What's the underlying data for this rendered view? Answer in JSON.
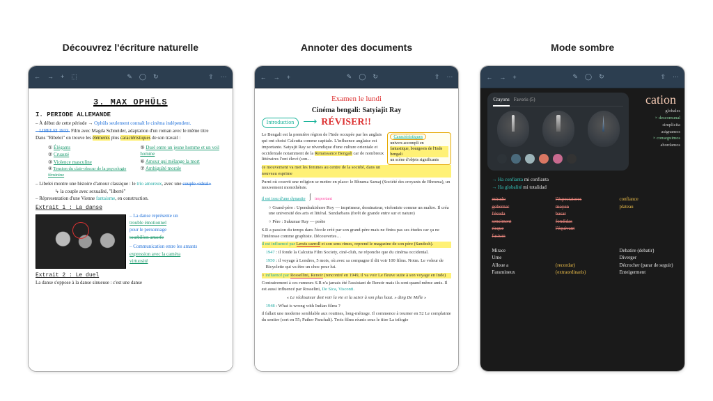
{
  "panels": [
    {
      "title": "Découvrez l'écriture naturelle"
    },
    {
      "title": "Annoter des documents"
    },
    {
      "title": "Mode sombre"
    }
  ],
  "toolbar_icons": [
    "←",
    "→",
    "+",
    "⊕",
    "✎",
    "⬚",
    "◯",
    "↻",
    "<",
    "—",
    "⋯"
  ],
  "panel1": {
    "heading": "3. MAX OPHÜLS",
    "section1": "I. PERIODE ALLEMANDE",
    "l1a": "– À début de cette période →",
    "l1b": "Ophüls seulement connaît le cinéma indépendent.",
    "l2a": "– LIBELEI 1933.",
    "l2b": "Film avec Magda Schneider, adaptation d'un roman avec le même titre",
    "l3a": "Dans \"Ribelei\" on trouve les",
    "l3b": "éléments",
    "l3c": "plus",
    "l3d": "caractéristiques",
    "l3e": "de son travail :",
    "col1": [
      "Élégants",
      "Cruauté",
      "Violence masculine",
      "Tension du clair-obscur de la psycologie féminine"
    ],
    "col2": [
      "Duel entre un jeune homme et un veil homme",
      "Amour qui mélange la mort",
      "Ambiguïté morale"
    ],
    "l4a": "– Libelei montre une histoire d'amour classique : le",
    "l4b": "trio amoreux",
    "l4c": ", avec une",
    "l4d": "couple «ideal»",
    "l4e": "↳ la couple avec sexualité, \"liberté\"",
    "l5a": "– Répresentation d'une Vienne",
    "l5b": "fantaisme",
    "l5c": ", en construction.",
    "extrait1": "Extrait 1 : La danse",
    "p1": [
      "– La danse représente un",
      "trouble émotionnel",
      "pour le personnage",
      "tourbillon amorfe"
    ],
    "p2": [
      "– Communication entre les amants",
      "expression avec la caméra",
      "virtuosité"
    ],
    "extrait2": "Extrait 2 : Le duel",
    "last": "La danse s'oppose à la danse sinueuse : c'est une danse"
  },
  "panel2": {
    "exam": "Examen le lundi",
    "title": "Cinéma bengali: Satyiajit Ray",
    "intro": "Introduction",
    "reviser": "RÉVISER!!",
    "carac_label": "Caractéristiques",
    "carac_lines": [
      "univers accompli en",
      "fantastique, bourgeois de l'Inde bengali",
      "un scène d'objets significants"
    ],
    "body1": "Le Bengali est la première région de l'Inde occupée par les anglais qui ont choisi Calcutta comme capitale. L'influence anglaise est importante. Satyajit Ray se révendique d'une culture orientale et",
    "body1b": "occidentale notamment de la",
    "body1c": "Renaissance Bengali",
    "body1d": "car de nombreux littéraires l'ont élevé (son...",
    "hl1": "ce mouvement va met les femmes au centre de la société, dans un nouveau esprime",
    "body2": "Purni où couvrit une religion se mettre en place: le Bhrama Samaj (Société des croyants de Bhruma), un mouvement monothéiste.",
    "important": "important",
    "under": "il est issu d'une dynastie",
    "dyn": [
      "Grand-père : Upendrakishore Roy — imprimeur, dessinateur, violoniste comme un maître. Il créa une université des arts et littéral. Sundarbans (forêt de grande entre sur et nature)",
      "Père : Sukumar Ray — poète"
    ],
    "sr": "S.R a passion du temps dans l'école créé par son grand-père mais ne finira pas ses études car ça ne l'intéresse comme graphiste. Découvertes…",
    "infl_label": "il est influencé par",
    "lewis": "Lewis carroll",
    "infl_rest": "et son sens rimes, reprend le magazine de son père (Sandesh).",
    "y1947": "1947",
    "y1947t": "il fonde la Calcutta Film Society, ciné-club, ne réponche que du cinéma occidental.",
    "y1950": "1950",
    "y1950t": "il voyage à Londres, 5 mois, où avec sa compagne il dit voir 100 films. Notm. Le voleur de Bicyclette qui va être un choc pour lui.",
    "rosse_label": "influencé par",
    "rosse": "Rossellini, Renoir",
    "rosse_rest": "(rencontré en 1949, il va voir Le fleuve suite à son voyage en Inde)",
    "rosse2": "Contrairement à ces rumeurs S.R n'a jamais été l'assistant de Renoir mais ils sont quand même amis. Il est aussi influencé par Rosselini,",
    "names": "De Sica, Visconti.",
    "quote": "« Le réalisateur doit voir la vie et la saisir à son plus haut. » dtng De Mille »",
    "y1948": "1948",
    "y1948t": "What is wrong with Indian films ?",
    "tail": "il fallait une moderne semblable aux routines, long-métrage. Il commence à tourner en 52 Le complainte du sentier (sort en 55; Pather Panchali). Trois films réunis sous le titre La trilogie"
  },
  "panel3": {
    "script": "cation",
    "tab1": "Crayons",
    "tab2": "Favoris (5)",
    "sidewords": [
      "globales",
      "× descomunal",
      "simplicita",
      "asignamos",
      "× conseguimos",
      "abordamos"
    ],
    "swatches": [
      "#2d3338",
      "#4a6a7c",
      "#9cb4b9",
      "#d97763",
      "#c86a8f",
      "#333333"
    ],
    "line1a": "→ Ha confianta",
    "line1b": "mi confianta",
    "line2a": "→ Ha globalité",
    "line2b": "mi totalidad",
    "gridL": [
      "mirado",
      "gobernar",
      "l'ésuda",
      "sensiment",
      "risque",
      "fusium"
    ],
    "gridM": [
      "l'éspectatores",
      "moyen",
      "basar",
      "fondidas",
      "l'équivant",
      ""
    ],
    "gridR": [
      "confiance",
      "plateau",
      "",
      "",
      "",
      ""
    ],
    "bottom": [
      [
        "Mirace",
        "",
        "Debatire (debatir)"
      ],
      [
        "Urne",
        "",
        "Diverger"
      ],
      [
        "Alloue a",
        "(recordar)",
        "Décrocher (parar de seguir)"
      ],
      [
        "Faramineux",
        "(extraordinaris)",
        "Enteigerment"
      ]
    ]
  }
}
